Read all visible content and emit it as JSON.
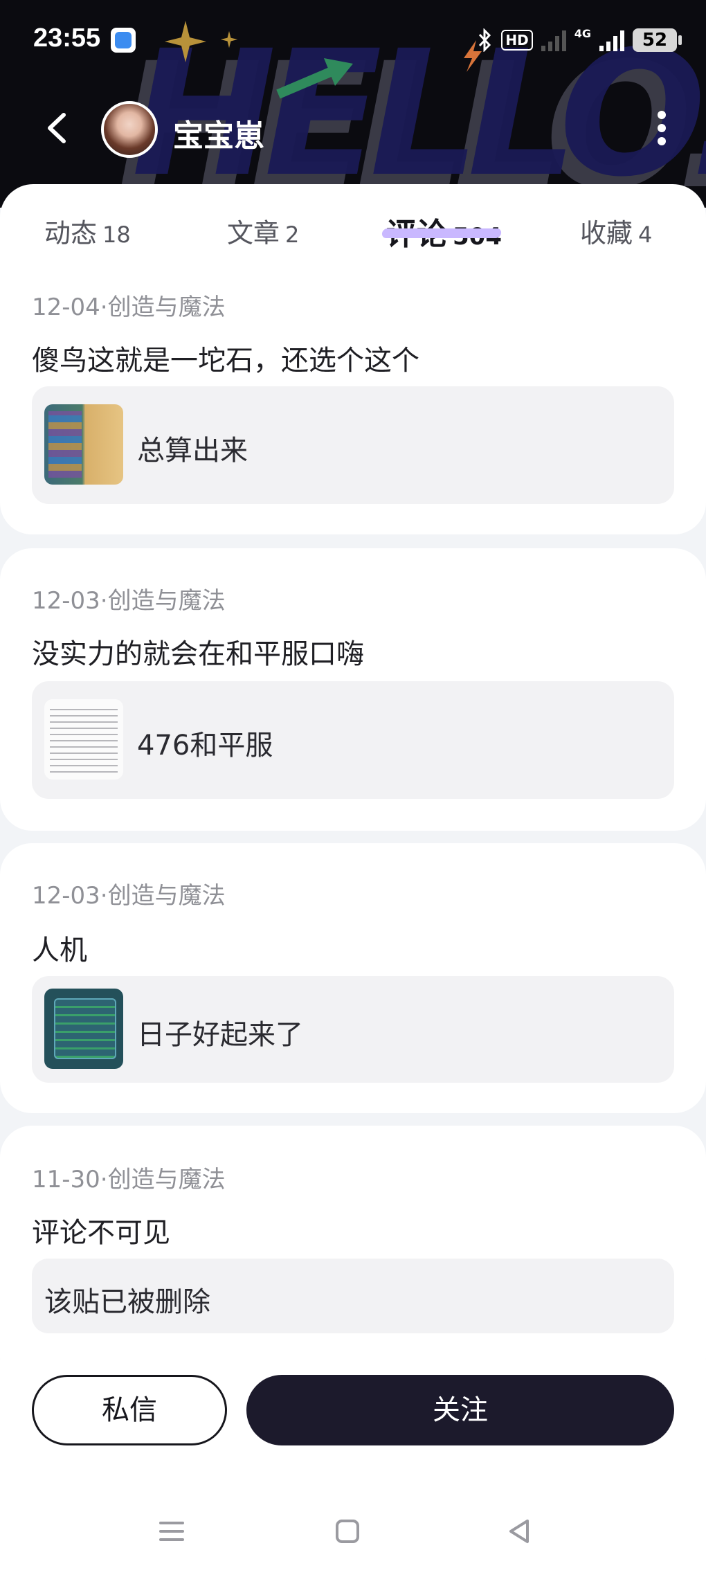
{
  "status_bar": {
    "time": "23:55",
    "hd_label": "HD",
    "net_label": "4G",
    "battery": "52"
  },
  "header": {
    "background_text": "HELLO.",
    "nickname": "宝宝崽"
  },
  "tabs": [
    {
      "label": "动态",
      "count": "18"
    },
    {
      "label": "文章",
      "count": "2"
    },
    {
      "label": "评论",
      "count": "504",
      "active": true
    },
    {
      "label": "收藏",
      "count": "4"
    }
  ],
  "comments": [
    {
      "meta": "12-04·创造与魔法",
      "text": "傻鸟这就是一坨石，还选个这个",
      "ref": "总算出来",
      "thumb": "game-screenshot"
    },
    {
      "meta": "12-03·创造与魔法",
      "text": "没实力的就会在和平服口嗨",
      "ref": "476和平服",
      "thumb": "text-screenshot"
    },
    {
      "meta": "12-03·创造与魔法",
      "text": "人机",
      "ref": "日子好起来了",
      "thumb": "list-screenshot"
    },
    {
      "meta": "11-30·创造与魔法",
      "text": "评论不可见",
      "ref": "该贴已被删除",
      "thumb": ""
    }
  ],
  "actions": {
    "message_label": "私信",
    "follow_label": "关注"
  },
  "colors": {
    "header_bg": "#0b0b10",
    "follow_bg": "#1c1a2c",
    "tab_highlight": "#c9b8ff",
    "page_bg": "#f2f4f7"
  }
}
